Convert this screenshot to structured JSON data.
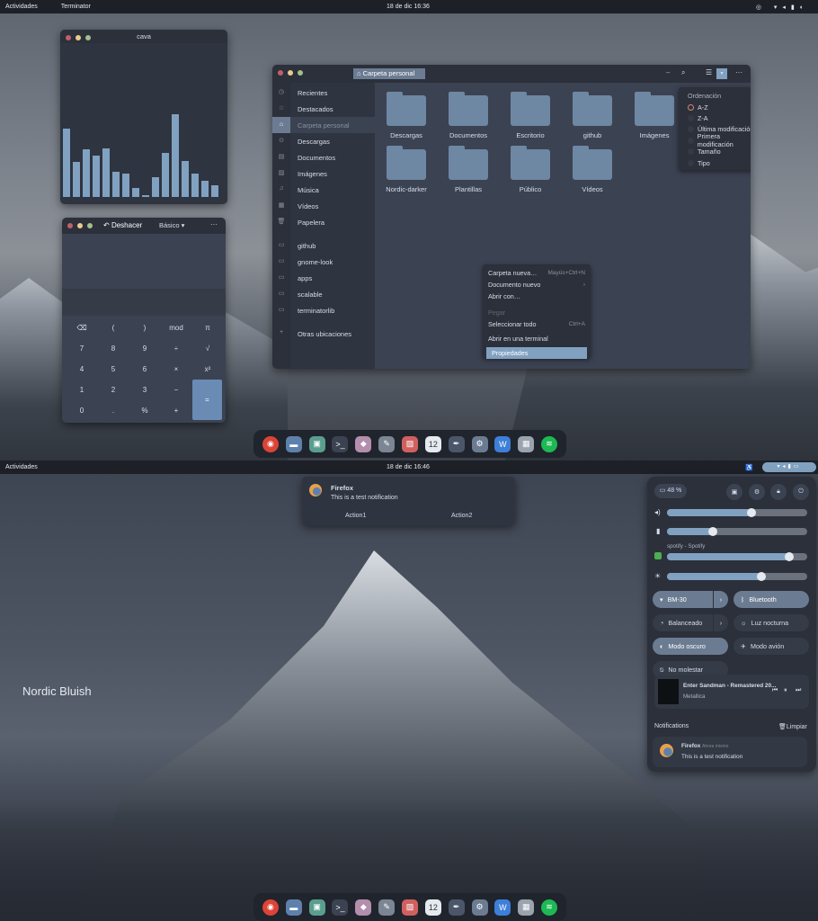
{
  "top": {
    "topbar": {
      "activities": "Actividades",
      "app": "Terminator",
      "clock": "18 de dic  16:36"
    },
    "cava": {
      "title": "cava",
      "levels": [
        0.83,
        0.42,
        0.58,
        0.5,
        0.59,
        0.3,
        0.28,
        0.11,
        0.02,
        0.24,
        0.53,
        1.0,
        0.44,
        0.28,
        0.2,
        0.14
      ]
    },
    "files": {
      "location": "Carpeta personal",
      "sidebar": [
        {
          "label": "Recientes",
          "icon": "clock-icon"
        },
        {
          "label": "Destacados",
          "icon": "star-icon"
        },
        {
          "label": "Carpeta personal",
          "icon": "home-icon"
        },
        {
          "label": "Descargas",
          "icon": "download-icon"
        },
        {
          "label": "Documentos",
          "icon": "document-icon"
        },
        {
          "label": "Imágenes",
          "icon": "image-icon"
        },
        {
          "label": "Música",
          "icon": "music-icon"
        },
        {
          "label": "Vídeos",
          "icon": "video-icon"
        },
        {
          "label": "Papelera",
          "icon": "trash-icon"
        },
        {
          "label": "github",
          "icon": "drive-icon"
        },
        {
          "label": "gnome-look",
          "icon": "drive-icon"
        },
        {
          "label": "apps",
          "icon": "drive-icon"
        },
        {
          "label": "scalable",
          "icon": "drive-icon"
        },
        {
          "label": "terminatorlib",
          "icon": "drive-icon"
        },
        {
          "label": "Otras ubicaciones",
          "icon": "plus-icon"
        }
      ],
      "folders": [
        "Descargas",
        "Documentos",
        "Escritorio",
        "github",
        "Imágenes",
        "Nordic-darker",
        "Plantillas",
        "Público",
        "Vídeos"
      ],
      "sort": {
        "title": "Ordenación",
        "options": [
          "A-Z",
          "Z-A",
          "Última modificación",
          "Primera modificación",
          "Tamaño",
          "Tipo"
        ],
        "selected": "A-Z"
      },
      "context_menu": [
        {
          "label": "Carpeta nueva…",
          "shortcut": "Mayús+Ctrl+N"
        },
        {
          "label": "Documento nuevo",
          "shortcut": "›"
        },
        {
          "label": "Abrir con…",
          "shortcut": ""
        },
        {
          "label": "Pegar",
          "shortcut": "",
          "disabled": true
        },
        {
          "label": "Seleccionar todo",
          "shortcut": "Ctrl+A"
        },
        {
          "label": "Abrir en una terminal",
          "shortcut": ""
        },
        {
          "label": "Propiedades",
          "shortcut": "",
          "highlighted": true
        }
      ]
    },
    "calc": {
      "undo": "Deshacer",
      "mode": "Básico",
      "keys": [
        "⌫",
        "(",
        ")",
        "mod",
        "π",
        "7",
        "8",
        "9",
        "÷",
        "√",
        "4",
        "5",
        "6",
        "×",
        "x²",
        "1",
        "2",
        "3",
        "−",
        "0",
        ".",
        "%",
        "+"
      ],
      "equals": "="
    }
  },
  "bottom": {
    "topbar": {
      "activities": "Actividades",
      "clock": "18 de dic  16:46"
    },
    "notification": {
      "app": "Firefox",
      "body": "This is a test notification",
      "actions": [
        "Action1",
        "Action2"
      ]
    },
    "wallpaper_label": "Nordic Bluish",
    "quick": {
      "battery": "48 %",
      "volume": 0.6,
      "mic": 0.33,
      "spotify_label": "spotify - Spotify",
      "spotify_volume": 0.87,
      "brightness": 0.67,
      "toggles": [
        {
          "label": "BM-30",
          "on": true,
          "arrow": true
        },
        {
          "label": "Bluetooth",
          "on": true
        },
        {
          "label": "Balanceado",
          "on": false,
          "arrow": true
        },
        {
          "label": "Luz nocturna",
          "on": false
        },
        {
          "label": "Modo oscuro",
          "on": true
        },
        {
          "label": "Modo avión",
          "on": false
        },
        {
          "label": "No molestar",
          "on": false
        }
      ],
      "media": {
        "title": "Enter Sandman - Remastered 20...",
        "artist": "Metallica"
      },
      "notifications_title": "Notifications",
      "clear": "Limpiar",
      "notif": {
        "app": "Firefox",
        "time": "Ahora mismo",
        "body": "This is a test notification"
      }
    }
  },
  "colors": {
    "accent": "#81a1c1",
    "bg": "#2e3440",
    "folder": "#6e87a3"
  }
}
